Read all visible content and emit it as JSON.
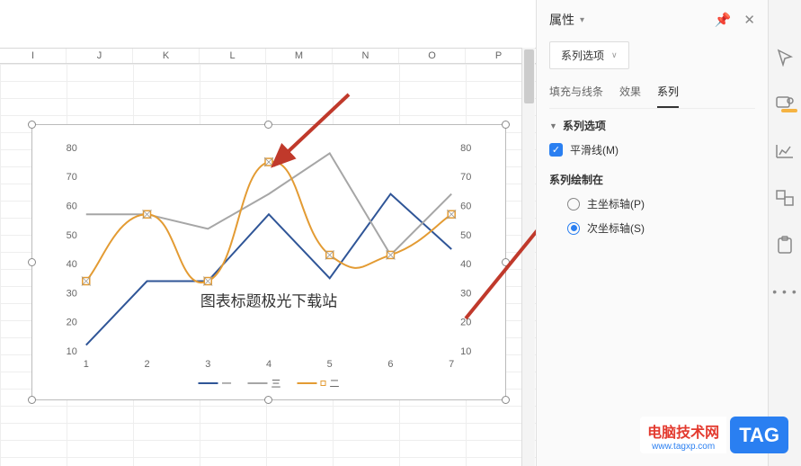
{
  "columns": [
    "I",
    "J",
    "K",
    "L",
    "M",
    "N",
    "O",
    "P"
  ],
  "panel": {
    "title": "属性",
    "dropdown": "系列选项",
    "tabs": {
      "fill": "填充与线条",
      "effect": "效果",
      "series": "系列"
    },
    "section": "系列选项",
    "smooth_label": "平滑线(M)",
    "smooth_checked": true,
    "plot_on_label": "系列绘制在",
    "radio_primary": "主坐标轴(P)",
    "radio_secondary": "次坐标轴(S)",
    "radio_selected": "secondary"
  },
  "watermark": {
    "line1": "电脑技术网",
    "line2": "www.tagxp.com",
    "tag": "TAG"
  },
  "chart_data": {
    "type": "line",
    "title": "图表标题极光下载站",
    "xlabel": "",
    "ylabel": "",
    "x": [
      1,
      2,
      3,
      4,
      5,
      6,
      7
    ],
    "y_left": {
      "min": 10,
      "max": 80,
      "ticks": [
        10,
        20,
        30,
        40,
        50,
        60,
        70,
        80
      ]
    },
    "y_right": {
      "min": 10,
      "max": 80,
      "ticks": [
        10,
        20,
        30,
        40,
        50,
        60,
        70,
        80
      ]
    },
    "series": [
      {
        "name": "一",
        "color": "#2f5597",
        "axis": "left",
        "style": "line",
        "values": [
          12,
          34,
          34,
          57,
          35,
          64,
          45
        ]
      },
      {
        "name": "三",
        "color": "#a6a6a6",
        "axis": "left",
        "style": "line",
        "values": [
          57,
          57,
          52,
          64,
          78,
          43,
          64
        ]
      },
      {
        "name": "二",
        "color": "#e39b33",
        "axis": "right",
        "style": "smooth",
        "values": [
          34,
          57,
          34,
          75,
          43,
          43,
          57
        ]
      }
    ],
    "legend": [
      "一",
      "三",
      "二"
    ]
  }
}
